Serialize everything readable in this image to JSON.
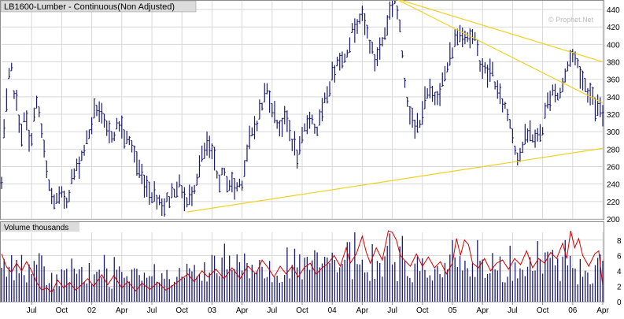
{
  "colors": {
    "background": "#ffffff",
    "plot_background": "#ffffff",
    "grid": "#d8d8d8",
    "frame": "#8c8c8c",
    "header_background": "#dcdcdc",
    "price_bar": "#1a1a6e",
    "trendline": "#f0d020",
    "volume_bar": "#1a1a6e",
    "open_interest_line": "#d00000",
    "text": "#000000",
    "watermark": "#bbbbbb"
  },
  "chart_data": [
    {
      "type": "bar",
      "title": "LB1600-Lumber - Continuous(Non Adjusted)",
      "watermark": "© Prophet.Net",
      "ylim": [
        200,
        450
      ],
      "y_ticks": [
        200,
        220,
        240,
        260,
        280,
        300,
        320,
        340,
        360,
        380,
        400,
        420,
        440
      ],
      "grid": true,
      "x_ticks": [
        {
          "label": "Jul",
          "t": 0.0
        },
        {
          "label": "Oct",
          "t": 3.0
        },
        {
          "label": "02",
          "t": 6.0
        },
        {
          "label": "Apr",
          "t": 9.0
        },
        {
          "label": "Jul",
          "t": 12.0
        },
        {
          "label": "Oct",
          "t": 15.0
        },
        {
          "label": "03",
          "t": 18.0
        },
        {
          "label": "Apr",
          "t": 21.0
        },
        {
          "label": "Jul",
          "t": 24.0
        },
        {
          "label": "Oct",
          "t": 27.0
        },
        {
          "label": "04",
          "t": 30.0
        },
        {
          "label": "Apr",
          "t": 33.0
        },
        {
          "label": "Jul",
          "t": 36.0
        },
        {
          "label": "Oct",
          "t": 39.0
        },
        {
          "label": "05",
          "t": 42.0
        },
        {
          "label": "Apr",
          "t": 45.0
        },
        {
          "label": "Jul",
          "t": 48.0
        },
        {
          "label": "Oct",
          "t": 51.0
        },
        {
          "label": "06",
          "t": 54.0
        },
        {
          "label": "Apr",
          "t": 57.0
        }
      ],
      "x_range": [
        -3.0,
        57.0
      ],
      "price_anchors": [
        [
          -3.0,
          240
        ],
        [
          -2.8,
          290
        ],
        [
          -2.4,
          345
        ],
        [
          -2.1,
          375
        ],
        [
          -1.5,
          330
        ],
        [
          -1.0,
          300
        ],
        [
          -0.6,
          320
        ],
        [
          -0.2,
          280
        ],
        [
          0.2,
          315
        ],
        [
          0.5,
          330
        ],
        [
          0.8,
          320
        ],
        [
          1.2,
          280
        ],
        [
          1.6,
          245
        ],
        [
          2.0,
          225
        ],
        [
          2.5,
          220
        ],
        [
          3.0,
          225
        ],
        [
          3.5,
          222
        ],
        [
          4.0,
          245
        ],
        [
          4.6,
          260
        ],
        [
          5.2,
          280
        ],
        [
          5.8,
          300
        ],
        [
          6.2,
          320
        ],
        [
          6.6,
          330
        ],
        [
          7.0,
          315
        ],
        [
          7.6,
          295
        ],
        [
          8.2,
          300
        ],
        [
          8.8,
          310
        ],
        [
          9.4,
          290
        ],
        [
          10.0,
          285
        ],
        [
          10.6,
          260
        ],
        [
          11.4,
          240
        ],
        [
          12.0,
          230
        ],
        [
          12.6,
          225
        ],
        [
          13.2,
          215
        ],
        [
          13.8,
          225
        ],
        [
          14.4,
          240
        ],
        [
          15.0,
          235
        ],
        [
          15.4,
          215
        ],
        [
          15.8,
          225
        ],
        [
          16.4,
          245
        ],
        [
          17.0,
          270
        ],
        [
          17.6,
          285
        ],
        [
          18.2,
          265
        ],
        [
          18.6,
          245
        ],
        [
          19.2,
          250
        ],
        [
          19.8,
          240
        ],
        [
          20.4,
          235
        ],
        [
          21.0,
          245
        ],
        [
          21.4,
          270
        ],
        [
          21.8,
          290
        ],
        [
          22.4,
          310
        ],
        [
          23.0,
          330
        ],
        [
          23.4,
          350
        ],
        [
          23.8,
          340
        ],
        [
          24.2,
          320
        ],
        [
          24.8,
          305
        ],
        [
          25.4,
          315
        ],
        [
          26.0,
          290
        ],
        [
          26.6,
          270
        ],
        [
          27.2,
          300
        ],
        [
          27.8,
          320
        ],
        [
          28.4,
          300
        ],
        [
          29.0,
          320
        ],
        [
          29.6,
          350
        ],
        [
          30.2,
          370
        ],
        [
          30.6,
          390
        ],
        [
          31.0,
          380
        ],
        [
          31.6,
          400
        ],
        [
          32.2,
          420
        ],
        [
          32.8,
          435
        ],
        [
          33.3,
          420
        ],
        [
          33.8,
          400
        ],
        [
          34.2,
          380
        ],
        [
          34.8,
          395
        ],
        [
          35.4,
          420
        ],
        [
          35.8,
          440
        ],
        [
          36.2,
          455
        ],
        [
          36.6,
          430
        ],
        [
          37.0,
          390
        ],
        [
          37.4,
          345
        ],
        [
          37.8,
          320
        ],
        [
          38.2,
          300
        ],
        [
          38.6,
          310
        ],
        [
          39.0,
          325
        ],
        [
          39.6,
          345
        ],
        [
          40.2,
          340
        ],
        [
          40.8,
          350
        ],
        [
          41.4,
          370
        ],
        [
          42.0,
          395
        ],
        [
          42.4,
          410
        ],
        [
          43.0,
          415
        ],
        [
          43.6,
          410
        ],
        [
          44.2,
          405
        ],
        [
          44.8,
          380
        ],
        [
          45.4,
          365
        ],
        [
          46.0,
          370
        ],
        [
          46.6,
          340
        ],
        [
          47.2,
          330
        ],
        [
          47.8,
          310
        ],
        [
          48.2,
          285
        ],
        [
          48.6,
          270
        ],
        [
          49.2,
          290
        ],
        [
          49.8,
          300
        ],
        [
          50.4,
          290
        ],
        [
          51.0,
          305
        ],
        [
          51.4,
          330
        ],
        [
          52.0,
          350
        ],
        [
          52.6,
          340
        ],
        [
          53.2,
          360
        ],
        [
          53.8,
          390
        ],
        [
          54.4,
          380
        ],
        [
          55.0,
          360
        ],
        [
          55.6,
          345
        ],
        [
          56.2,
          330
        ],
        [
          57.0,
          320
        ]
      ],
      "trendlines": [
        {
          "from": [
            15.5,
            208
          ],
          "to": [
            57.0,
            281
          ]
        },
        {
          "from": [
            36.2,
            453
          ],
          "to": [
            57.0,
            380
          ]
        },
        {
          "from": [
            36.2,
            453
          ],
          "to": [
            57.0,
            333
          ]
        }
      ]
    },
    {
      "type": "bar",
      "title": "Volume  thousands",
      "ylim": [
        0,
        9
      ],
      "y_ticks": [
        0,
        2,
        4,
        6,
        8
      ],
      "grid": true,
      "volume_anchors": [
        [
          -3.0,
          5.5
        ],
        [
          0.0,
          4.5
        ],
        [
          2.0,
          3.0
        ],
        [
          4.0,
          3.5
        ],
        [
          6.0,
          4.0
        ],
        [
          9.0,
          3.5
        ],
        [
          12.0,
          3.0
        ],
        [
          15.0,
          3.5
        ],
        [
          18.0,
          4.5
        ],
        [
          21.0,
          5.0
        ],
        [
          24.0,
          5.5
        ],
        [
          27.0,
          5.0
        ],
        [
          30.0,
          5.5
        ],
        [
          33.0,
          6.0
        ],
        [
          36.0,
          5.5
        ],
        [
          39.0,
          5.0
        ],
        [
          42.0,
          5.0
        ],
        [
          45.0,
          5.0
        ],
        [
          48.0,
          4.5
        ],
        [
          51.0,
          5.0
        ],
        [
          54.0,
          5.0
        ],
        [
          57.0,
          4.5
        ]
      ],
      "open_interest_anchors": [
        [
          -3.0,
          6.2
        ],
        [
          -2.5,
          4.5
        ],
        [
          -2.0,
          3.8
        ],
        [
          -1.5,
          5.0
        ],
        [
          -1.0,
          4.0
        ],
        [
          -0.5,
          5.2
        ],
        [
          0.0,
          4.0
        ],
        [
          0.5,
          2.5
        ],
        [
          1.0,
          1.5
        ],
        [
          1.5,
          1.8
        ],
        [
          2.0,
          1.2
        ],
        [
          2.6,
          2.8
        ],
        [
          3.2,
          1.8
        ],
        [
          3.8,
          2.5
        ],
        [
          4.4,
          1.5
        ],
        [
          5.0,
          2.2
        ],
        [
          5.6,
          3.0
        ],
        [
          6.2,
          2.0
        ],
        [
          7.0,
          3.5
        ],
        [
          7.6,
          2.2
        ],
        [
          8.2,
          3.4
        ],
        [
          9.0,
          1.8
        ],
        [
          9.6,
          2.6
        ],
        [
          10.4,
          1.4
        ],
        [
          11.0,
          2.4
        ],
        [
          11.8,
          1.6
        ],
        [
          12.6,
          2.5
        ],
        [
          13.4,
          1.5
        ],
        [
          14.2,
          2.2
        ],
        [
          15.0,
          3.0
        ],
        [
          15.6,
          3.6
        ],
        [
          16.2,
          2.6
        ],
        [
          17.0,
          4.0
        ],
        [
          17.6,
          3.2
        ],
        [
          18.4,
          4.2
        ],
        [
          19.2,
          3.0
        ],
        [
          20.0,
          4.4
        ],
        [
          20.8,
          3.0
        ],
        [
          21.6,
          4.6
        ],
        [
          22.4,
          3.6
        ],
        [
          23.0,
          5.4
        ],
        [
          23.6,
          4.4
        ],
        [
          24.2,
          3.2
        ],
        [
          24.8,
          4.6
        ],
        [
          25.4,
          3.6
        ],
        [
          26.0,
          4.6
        ],
        [
          26.6,
          3.2
        ],
        [
          27.2,
          4.4
        ],
        [
          27.8,
          5.0
        ],
        [
          28.4,
          3.6
        ],
        [
          29.0,
          4.4
        ],
        [
          29.6,
          5.0
        ],
        [
          30.2,
          6.0
        ],
        [
          30.8,
          4.6
        ],
        [
          31.4,
          7.0
        ],
        [
          31.8,
          5.0
        ],
        [
          32.4,
          6.2
        ],
        [
          33.0,
          8.5
        ],
        [
          33.4,
          6.4
        ],
        [
          33.8,
          5.0
        ],
        [
          34.4,
          7.0
        ],
        [
          35.0,
          5.4
        ],
        [
          35.6,
          9.2
        ],
        [
          36.0,
          9.0
        ],
        [
          36.4,
          8.0
        ],
        [
          36.8,
          6.0
        ],
        [
          37.2,
          5.4
        ],
        [
          37.8,
          4.6
        ],
        [
          38.4,
          6.2
        ],
        [
          39.0,
          4.6
        ],
        [
          39.6,
          5.8
        ],
        [
          40.2,
          4.4
        ],
        [
          40.8,
          5.2
        ],
        [
          41.4,
          3.6
        ],
        [
          42.0,
          5.0
        ],
        [
          42.4,
          8.2
        ],
        [
          42.8,
          6.0
        ],
        [
          43.2,
          8.0
        ],
        [
          43.6,
          7.4
        ],
        [
          44.0,
          5.0
        ],
        [
          44.6,
          4.4
        ],
        [
          45.2,
          5.6
        ],
        [
          45.8,
          4.0
        ],
        [
          46.4,
          5.0
        ],
        [
          47.0,
          5.4
        ],
        [
          47.6,
          4.2
        ],
        [
          48.2,
          5.6
        ],
        [
          48.8,
          4.8
        ],
        [
          49.4,
          6.6
        ],
        [
          50.0,
          4.4
        ],
        [
          50.6,
          5.6
        ],
        [
          51.2,
          5.0
        ],
        [
          51.8,
          6.4
        ],
        [
          52.4,
          5.6
        ],
        [
          53.0,
          7.6
        ],
        [
          53.4,
          5.6
        ],
        [
          53.8,
          9.2
        ],
        [
          54.2,
          7.0
        ],
        [
          54.6,
          8.2
        ],
        [
          55.0,
          6.0
        ],
        [
          55.6,
          4.6
        ],
        [
          56.2,
          6.2
        ],
        [
          56.6,
          6.6
        ],
        [
          57.0,
          2.0
        ]
      ]
    }
  ]
}
